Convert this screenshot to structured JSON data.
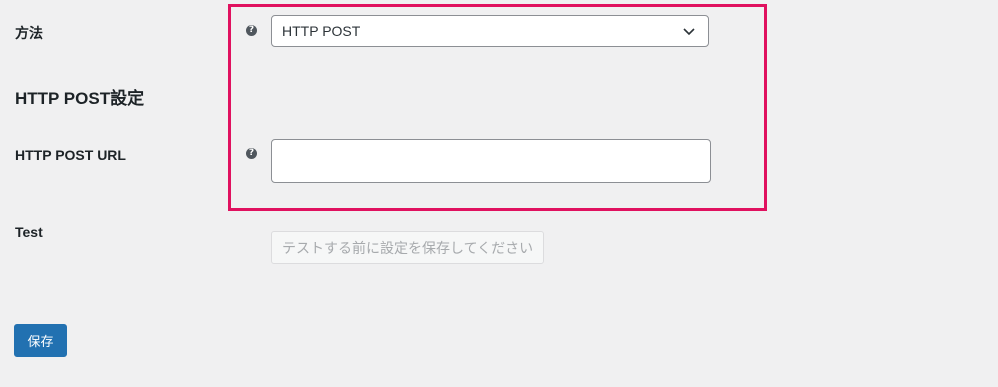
{
  "fields": {
    "method": {
      "label": "方法",
      "selected": "HTTP POST",
      "help_icon": "question-circle-icon",
      "chevron_icon": "chevron-down-icon"
    },
    "section_title": "HTTP POST設定",
    "url": {
      "label": "HTTP POST URL",
      "value": "",
      "help_icon": "question-circle-icon"
    },
    "test": {
      "label": "Test",
      "button_label": "テストする前に設定を保存してください"
    }
  },
  "actions": {
    "save_label": "保存"
  },
  "colors": {
    "background": "#f0f0f1",
    "highlight_border": "#e0115f",
    "primary_button": "#2271b1"
  }
}
